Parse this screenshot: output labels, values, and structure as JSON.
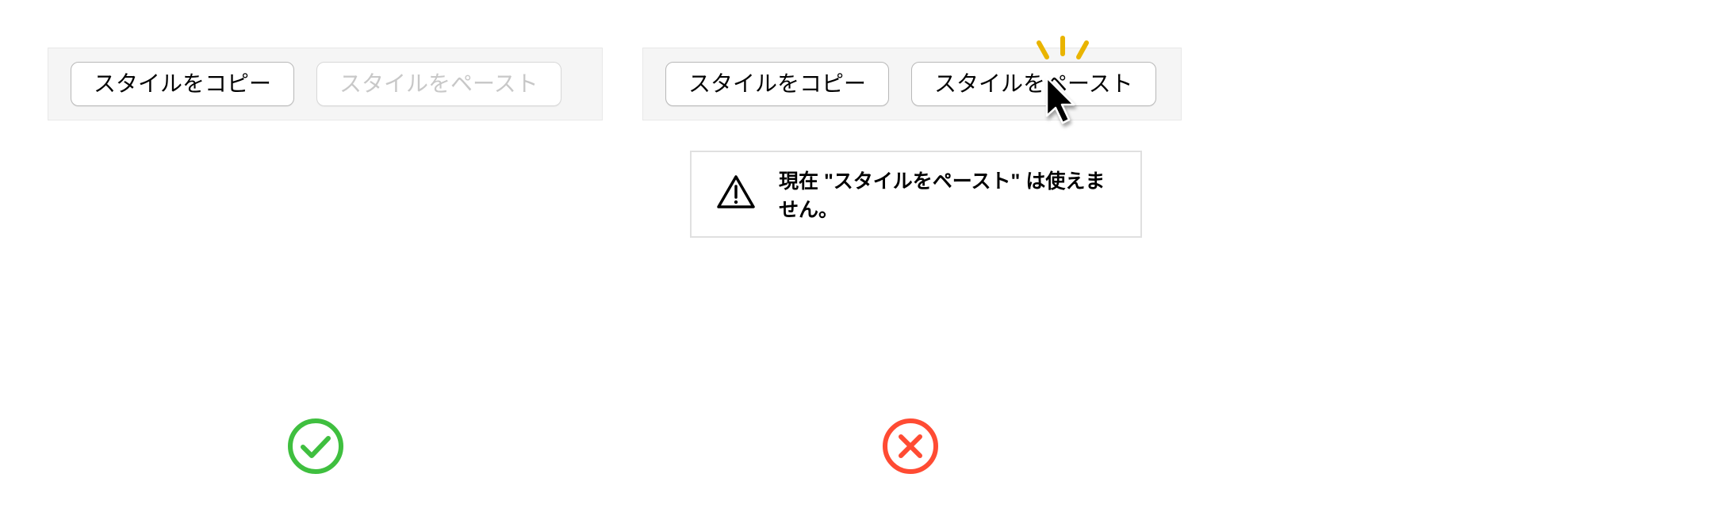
{
  "left_example": {
    "copy_button_label": "スタイルをコピー",
    "paste_button_label": "スタイルをペースト",
    "paste_button_disabled": true,
    "status": "correct"
  },
  "right_example": {
    "copy_button_label": "スタイルをコピー",
    "paste_button_label": "スタイルをペースト",
    "paste_button_disabled": false,
    "status": "incorrect"
  },
  "alert": {
    "message": "現在 \"スタイルをペースト\" は使えません。"
  },
  "colors": {
    "correct": "#3fbf3f",
    "incorrect": "#ff4b33",
    "spark": "#e9b400"
  }
}
